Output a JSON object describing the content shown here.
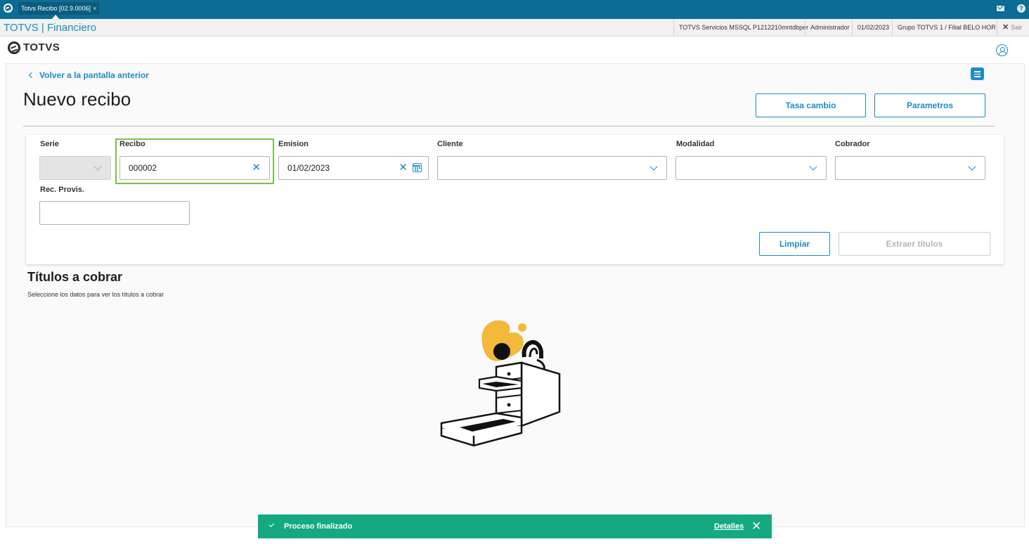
{
  "topbar": {
    "tab_label": "Totvs Recibo [02.9.0006]",
    "tab_close": "×"
  },
  "header": {
    "app_title": "TOTVS | Financiero",
    "server": "TOTVS Servicios MSSQL P1212210mntdbper",
    "user": "Administrador",
    "date": "01/02/2023",
    "branch": "Grupo TOTVS 1 / Filial BELO HOR",
    "exit_label": "Sair"
  },
  "brand": {
    "logo_text": "TOTVS"
  },
  "page": {
    "back_label": "Volver a la pantalla anterior",
    "title": "Nuevo recibo",
    "btn_tasa": "Tasa cambio",
    "btn_parametros": "Parametros"
  },
  "form": {
    "serie": {
      "label": "Serie",
      "value": ""
    },
    "recibo": {
      "label": "Recibo",
      "value": "000002"
    },
    "emision": {
      "label": "Emision",
      "value": "01/02/2023"
    },
    "cliente": {
      "label": "Cliente",
      "value": ""
    },
    "modalidad": {
      "label": "Modalidad",
      "value": ""
    },
    "cobrador": {
      "label": "Cobrador",
      "value": ""
    },
    "rec_provis": {
      "label": "Rec. Provis.",
      "value": ""
    },
    "btn_limpiar": "Limpiar",
    "btn_extraer": "Extraer títulos"
  },
  "titulos": {
    "title": "Títulos a cobrar",
    "subtitle": "Seleccione los datos para ver los títulos a cobrar"
  },
  "toast": {
    "message": "Proceso finalizado",
    "details": "Detalles",
    "close": "✕",
    "color": "#14a981"
  },
  "colors": {
    "primary": "#1e8bc3",
    "topbar": "#0c6c94",
    "highlight": "#7ac143"
  }
}
